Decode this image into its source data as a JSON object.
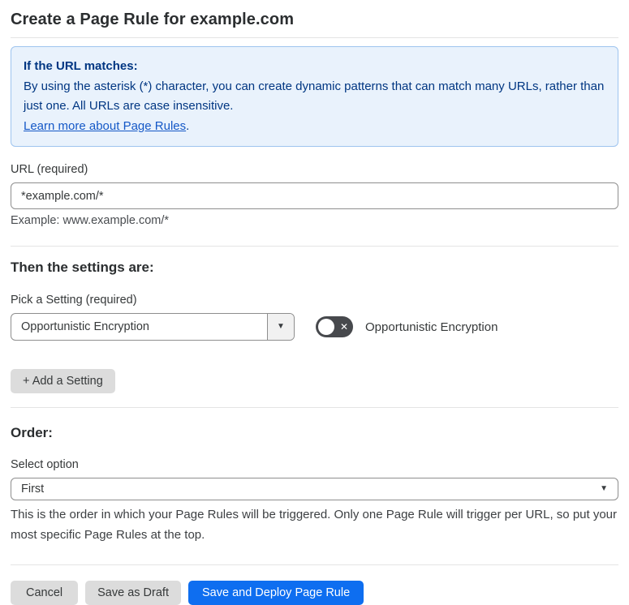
{
  "page": {
    "title": "Create a Page Rule for example.com"
  },
  "info_box": {
    "heading": "If the URL matches:",
    "body": "By using the asterisk (*) character, you can create dynamic patterns that can match many URLs, rather than just one. All URLs are case insensitive.",
    "link_text": "Learn more about Page Rules",
    "link_suffix": "."
  },
  "url_field": {
    "label": "URL (required)",
    "value": "*example.com/*",
    "helper": "Example: www.example.com/*"
  },
  "settings_section": {
    "heading": "Then the settings are:",
    "picker_label": "Pick a Setting (required)",
    "selected_setting": "Opportunistic Encryption",
    "toggle_state": "off",
    "toggle_label": "Opportunistic Encryption",
    "add_setting_button": "+ Add a Setting"
  },
  "order_section": {
    "heading": "Order:",
    "select_label": "Select option",
    "selected_option": "First",
    "helper": "This is the order in which your Page Rules will be triggered. Only one Page Rule will trigger per URL, so put your most specific Page Rules at the top."
  },
  "footer": {
    "cancel_label": "Cancel",
    "save_draft_label": "Save as Draft",
    "save_deploy_label": "Save and Deploy Page Rule"
  },
  "icons": {
    "caret_glyph": "▼",
    "close_glyph": "✕"
  },
  "colors": {
    "accent_blue": "#0e6ef0",
    "info_background": "#e9f2fc",
    "info_border": "#9ec4ef",
    "info_text": "#003682",
    "link_blue": "#1458c7",
    "toggle_off_background": "#47494d",
    "button_gray": "#dcdcdc"
  }
}
